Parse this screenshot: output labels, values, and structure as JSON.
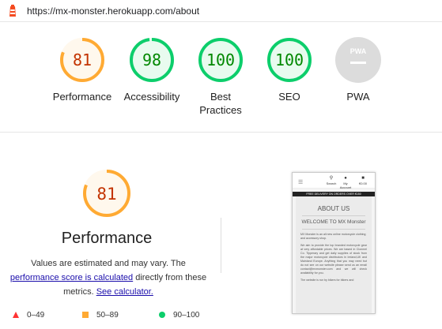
{
  "browser": {
    "url": "https://mx-monster.herokuapp.com/about",
    "logo_icon": "lighthouse-icon"
  },
  "colors": {
    "fail": "#ff3333",
    "average": "#ffaa33",
    "pass": "#0cce6b",
    "average_text": "#c33300",
    "pass_text": "#008800",
    "pwa_gray": "#cccccc"
  },
  "scores": [
    {
      "id": "performance",
      "value": "81",
      "label": "Performance",
      "rating": "average"
    },
    {
      "id": "accessibility",
      "value": "98",
      "label": "Accessibility",
      "rating": "pass"
    },
    {
      "id": "best-practices",
      "value": "100",
      "label": "Best Practices",
      "rating": "pass"
    },
    {
      "id": "seo",
      "value": "100",
      "label": "SEO",
      "rating": "pass"
    },
    {
      "id": "pwa",
      "value": "PWA",
      "label": "PWA",
      "rating": "na"
    }
  ],
  "performance": {
    "score": "81",
    "title": "Performance",
    "note_prefix": "Values are estimated and may vary. The",
    "score_link": "performance score is calculated",
    "note_middle": "directly from these metrics.",
    "calc_link": "See calculator.",
    "legend": [
      {
        "range": "0–49",
        "icon": "triangle-icon"
      },
      {
        "range": "50–89",
        "icon": "square-icon"
      },
      {
        "range": "90–100",
        "icon": "circle-icon"
      }
    ]
  },
  "screenshot": {
    "nav": {
      "search": "Search",
      "account": "My Account",
      "cart": "€0.00"
    },
    "banner": "FREE DELIVERY ON ORDERS OVER €150",
    "heading": "ABOUT US",
    "welcome": "WELCOME TO MX Monster",
    "para1": "MX Monster is an all new online motorcycle clothing and accessory shop.",
    "para2": "We aim to provide the top branded motorcycle gear at very affordable prices. We are based in Clonmel Co. Tipperary and get daily supplies of stock from the major motorcycle distributors in Ireland,UK and Mainland Europe. Anything that you may need but do not see on our website please send us an email contact@mxmonster.com and we will check availability for you.",
    "para3": "The website is run by bikers for bikers and"
  }
}
